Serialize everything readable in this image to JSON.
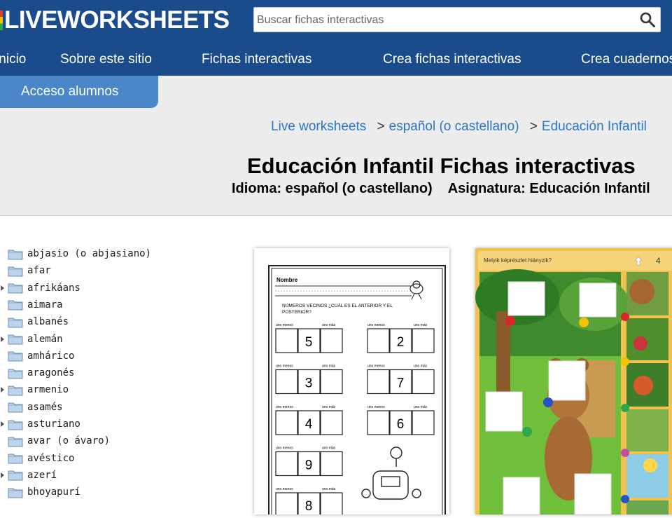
{
  "header": {
    "logo_text": "LIVEWORKSHEETS",
    "search_placeholder": "Buscar fichas interactivas"
  },
  "nav": {
    "items": [
      "Inicio",
      "Sobre este sitio",
      "Fichas interactivas",
      "Crea fichas interactivas",
      "Crea cuadernos"
    ],
    "student_access": "Acceso alumnos"
  },
  "breadcrumb": {
    "items": [
      "Live worksheets",
      "español (o castellano)",
      "Educación Infantil"
    ],
    "separator": ">"
  },
  "page": {
    "title": "Educación Infantil Fichas interactivas",
    "language_label": "Idioma: español (o castellano)",
    "subject_label": "Asignatura: Educación Infantil"
  },
  "sidebar": {
    "languages": [
      {
        "label": "abjasio (o abjasiano)",
        "expandable": false
      },
      {
        "label": "afar",
        "expandable": false
      },
      {
        "label": "afrikáans",
        "expandable": true
      },
      {
        "label": "aimara",
        "expandable": false
      },
      {
        "label": "albanés",
        "expandable": false
      },
      {
        "label": "alemán",
        "expandable": true
      },
      {
        "label": "amhárico",
        "expandable": false
      },
      {
        "label": "aragonés",
        "expandable": false
      },
      {
        "label": "armenio",
        "expandable": true
      },
      {
        "label": "asamés",
        "expandable": false
      },
      {
        "label": "asturiano",
        "expandable": true
      },
      {
        "label": "avar (o ávaro)",
        "expandable": false
      },
      {
        "label": "avéstico",
        "expandable": false
      },
      {
        "label": "azerí",
        "expandable": true
      },
      {
        "label": "bhoyapurí",
        "expandable": false
      }
    ]
  },
  "worksheets": {
    "card1": {
      "name_label": "Nombre",
      "instruction": "NÚMEROS VECINOS ¿CUÁL ES EL ANTERIOR Y EL POSTERIOR?",
      "before_label": "uno menos",
      "after_label": "uno más",
      "left_numbers": [
        "5",
        "3",
        "4",
        "9",
        "8"
      ],
      "right_numbers": [
        "2",
        "7",
        "6"
      ]
    },
    "card2": {
      "question": "Melyik képrészlet hiányzik?",
      "count": "4"
    }
  },
  "colors": {
    "header_blue": "#1a4c8b",
    "tab_blue": "#4a86c8",
    "link_blue": "#2b76c9",
    "gray_band": "#ececec"
  }
}
